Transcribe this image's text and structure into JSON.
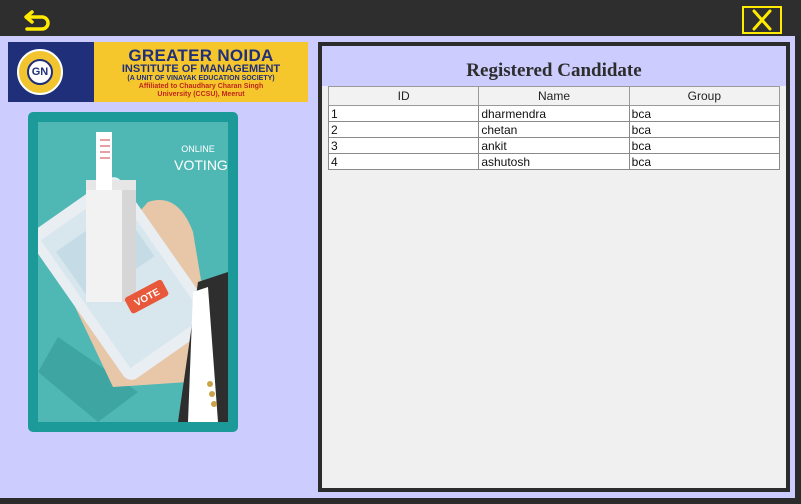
{
  "window": {
    "back_icon": "undo-arrow-icon",
    "close_icon": "close-x-icon",
    "accent_color": "#ffea00",
    "background": "#ccccff"
  },
  "logo": {
    "badge_text": "GN",
    "line1": "GREATER NOIDA",
    "line2": "INSTITUTE OF MANAGEMENT",
    "line3": "(A UNIT OF VINAYAK EDUCATION SOCIETY)",
    "line4": "Affiliated to Chaudhary Charan Singh",
    "line5": "University (CCSU), Meerut"
  },
  "poster": {
    "line1": "ONLINE",
    "line2": "VOTING",
    "vote_label": "VOTE"
  },
  "table": {
    "title": "Registered Candidate",
    "headers": {
      "id": "ID",
      "name": "Name",
      "group": "Group"
    },
    "rows": [
      {
        "id": "1",
        "name": "dharmendra",
        "group": "bca"
      },
      {
        "id": "2",
        "name": "chetan",
        "group": "bca"
      },
      {
        "id": "3",
        "name": "ankit",
        "group": "bca"
      },
      {
        "id": "4",
        "name": "ashutosh",
        "group": "bca"
      }
    ]
  }
}
